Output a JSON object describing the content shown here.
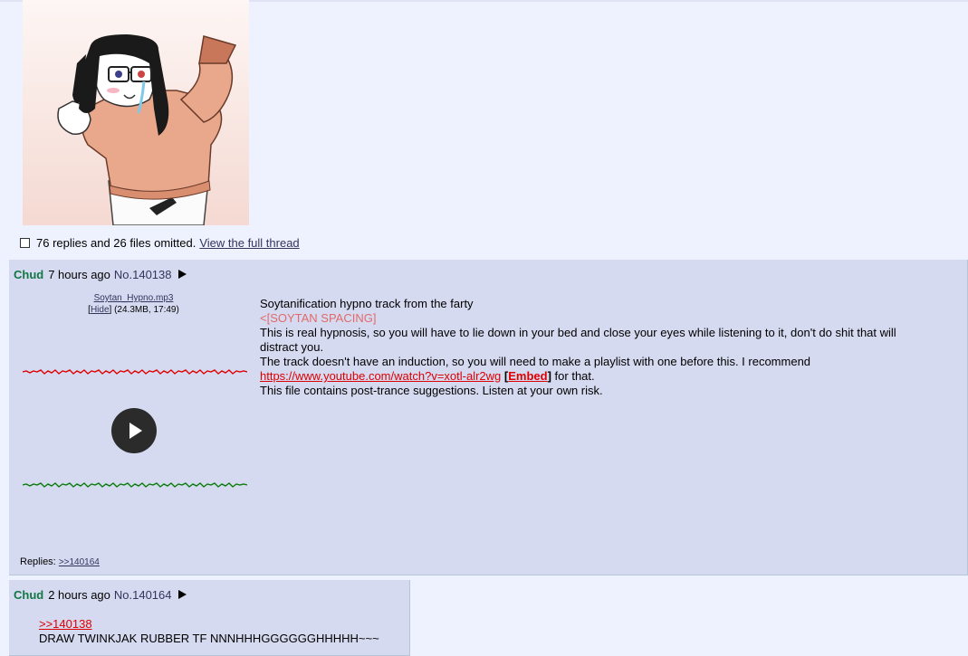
{
  "omitted": {
    "text": "76 replies and 26 files omitted.",
    "link": "View the full thread"
  },
  "posts": [
    {
      "name": "Chud",
      "time": "7 hours ago",
      "number": "No.140138",
      "file": {
        "filename": "Soytan_Hypno.mp3",
        "hide_label": "Hide",
        "info": "(24.3MB, 17:49)"
      },
      "message": {
        "line1": "Soytanification hypno track from the farty",
        "line2": "<[SOYTAN SPACING]",
        "line3": "This is real hypnosis, so you will have to lie down in your bed and close your eyes while listening to it, don't do shit that will distract you.",
        "line4": "The track doesn't have an induction, so you will need to make a playlist with one before this. I recommend",
        "link": "https://www.youtube.com/watch?v=xotl-alr2wg",
        "embed": "Embed",
        "link_suffix": "for that.",
        "line6": "This file contains post-trance suggestions. Listen at your own risk."
      },
      "replies_label": "Replies:",
      "replies": [
        ">>140164"
      ]
    },
    {
      "name": "Chud",
      "time": "2 hours ago",
      "number": "No.140164",
      "quote": ">>140138",
      "text": "DRAW TWINKJAK RUBBER TF NNNHHHGGGGGGHHHHH~~~"
    }
  ],
  "colors": {
    "background": "#eef2ff",
    "reply_bg": "#d6daf0",
    "name": "#117743",
    "link": "#34345c",
    "quote": "#dd0000"
  }
}
